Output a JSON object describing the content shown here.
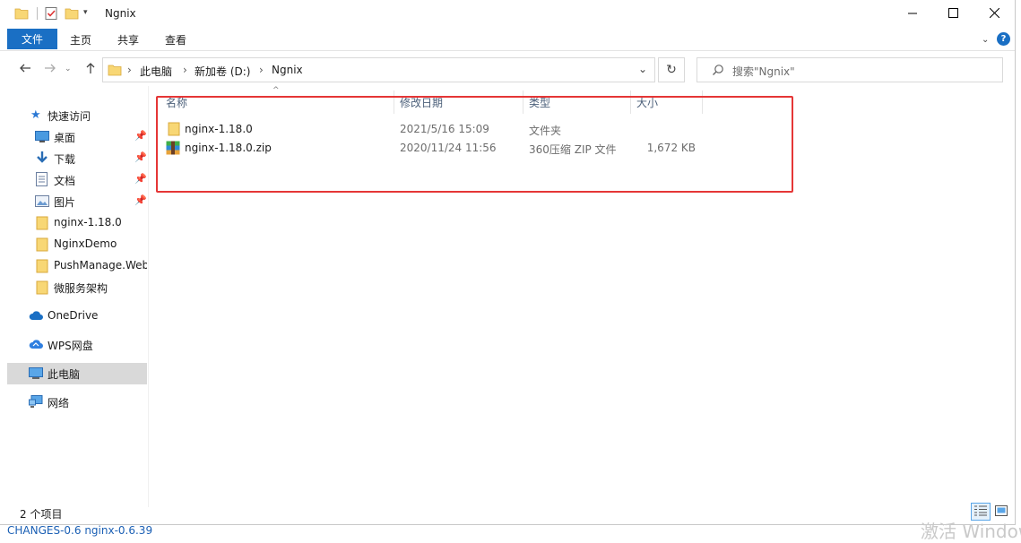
{
  "window": {
    "title": "Ngnix",
    "controls": {
      "minimize": "minimize-icon",
      "maximize": "maximize-icon",
      "close": "close-icon"
    }
  },
  "ribbon": {
    "tabs": [
      "文件",
      "主页",
      "共享",
      "查看"
    ]
  },
  "address": {
    "breadcrumbs": [
      "此电脑",
      "新加卷 (D:)",
      "Ngnix"
    ]
  },
  "search": {
    "placeholder": "搜索\"Ngnix\""
  },
  "nav": {
    "quick_access": "快速访问",
    "items": [
      {
        "label": "桌面",
        "icon": "desktop-icon",
        "pinned": true
      },
      {
        "label": "下载",
        "icon": "download-icon",
        "pinned": true
      },
      {
        "label": "文档",
        "icon": "document-icon",
        "pinned": true
      },
      {
        "label": "图片",
        "icon": "pictures-icon",
        "pinned": true
      },
      {
        "label": "nginx-1.18.0",
        "icon": "folder-icon",
        "pinned": false
      },
      {
        "label": "NginxDemo",
        "icon": "folder-icon",
        "pinned": false
      },
      {
        "label": "PushManage.Web",
        "icon": "folder-icon",
        "pinned": false
      },
      {
        "label": "微服务架构",
        "icon": "folder-icon",
        "pinned": false
      }
    ],
    "onedrive": "OneDrive",
    "wps": "WPS网盘",
    "this_pc": "此电脑",
    "network": "网络"
  },
  "columns": [
    "名称",
    "修改日期",
    "类型",
    "大小"
  ],
  "files": [
    {
      "name": "nginx-1.18.0",
      "modified": "2021/5/16 15:09",
      "type": "文件夹",
      "size": "",
      "icon": "folder-icon"
    },
    {
      "name": "nginx-1.18.0.zip",
      "modified": "2020/11/24 11:56",
      "type": "360压缩 ZIP 文件",
      "size": "1,672 KB",
      "icon": "zip-archive-icon"
    }
  ],
  "status": {
    "count": "2 个项目"
  },
  "background": {
    "behind_text": "CHANGES-0.6       nginx-0.6.39",
    "watermark": "激活 Windows"
  },
  "colors": {
    "accent": "#1a6fc4",
    "highlight_border": "#e53636",
    "selected_nav": "#d9d9d9"
  }
}
